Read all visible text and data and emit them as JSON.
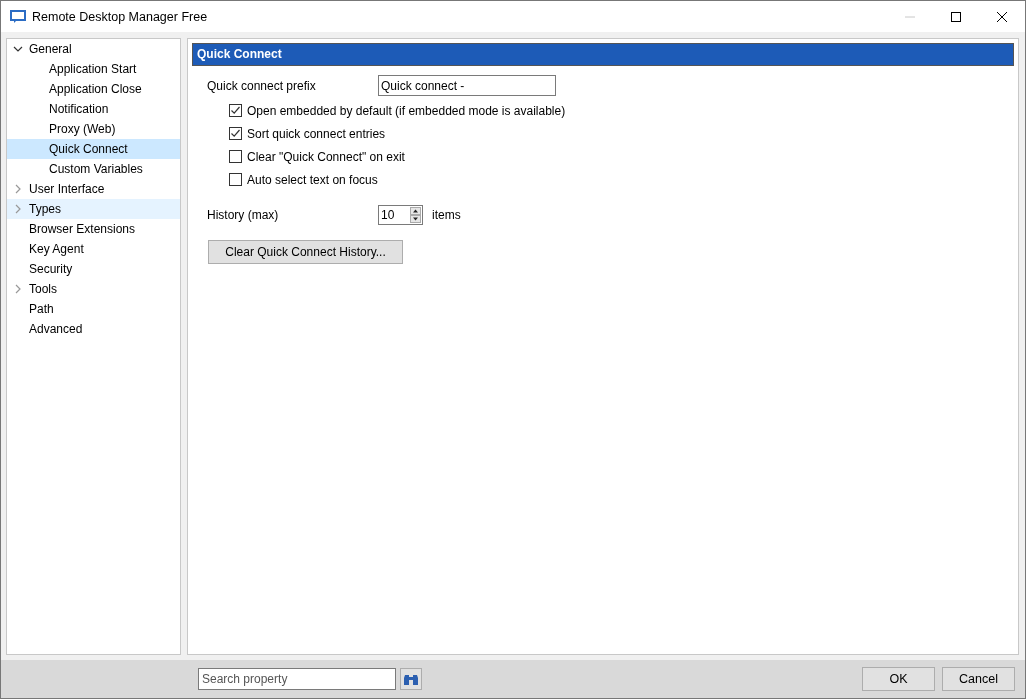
{
  "window": {
    "title": "Remote Desktop Manager Free",
    "minimize_disabled": true
  },
  "sidebar": {
    "items": [
      {
        "label": "General",
        "expanded": true,
        "selected": false,
        "hovered": false,
        "children": [
          {
            "label": "Application Start",
            "selected": false,
            "hovered": false
          },
          {
            "label": "Application Close",
            "selected": false,
            "hovered": false
          },
          {
            "label": "Notification",
            "selected": false,
            "hovered": false
          },
          {
            "label": "Proxy (Web)",
            "selected": false,
            "hovered": false
          },
          {
            "label": "Quick Connect",
            "selected": true,
            "hovered": false
          },
          {
            "label": "Custom Variables",
            "selected": false,
            "hovered": false
          }
        ]
      },
      {
        "label": "User Interface",
        "expanded": false,
        "selected": false,
        "hovered": false
      },
      {
        "label": "Types",
        "expanded": false,
        "selected": false,
        "hovered": true
      },
      {
        "label": "Browser Extensions",
        "selected": false,
        "hovered": false
      },
      {
        "label": "Key Agent",
        "selected": false,
        "hovered": false
      },
      {
        "label": "Security",
        "selected": false,
        "hovered": false
      },
      {
        "label": "Tools",
        "expanded": false,
        "selected": false,
        "hovered": false
      },
      {
        "label": "Path",
        "selected": false,
        "hovered": false
      },
      {
        "label": "Advanced",
        "selected": false,
        "hovered": false
      }
    ]
  },
  "panel": {
    "title": "Quick Connect",
    "prefix": {
      "label": "Quick connect prefix",
      "value": "Quick connect -"
    },
    "options": [
      {
        "label": "Open embedded by default (if embedded mode is available)",
        "checked": true
      },
      {
        "label": "Sort quick connect entries",
        "checked": true
      },
      {
        "label": "Clear \"Quick Connect\" on exit",
        "checked": false
      },
      {
        "label": "Auto select text on focus",
        "checked": false
      }
    ],
    "history": {
      "label": "History (max)",
      "value": "10",
      "unit": "items"
    },
    "clear_button": "Clear Quick Connect History..."
  },
  "footer": {
    "search": {
      "placeholder": "Search property"
    },
    "buttons": [
      "OK",
      "Cancel"
    ]
  }
}
